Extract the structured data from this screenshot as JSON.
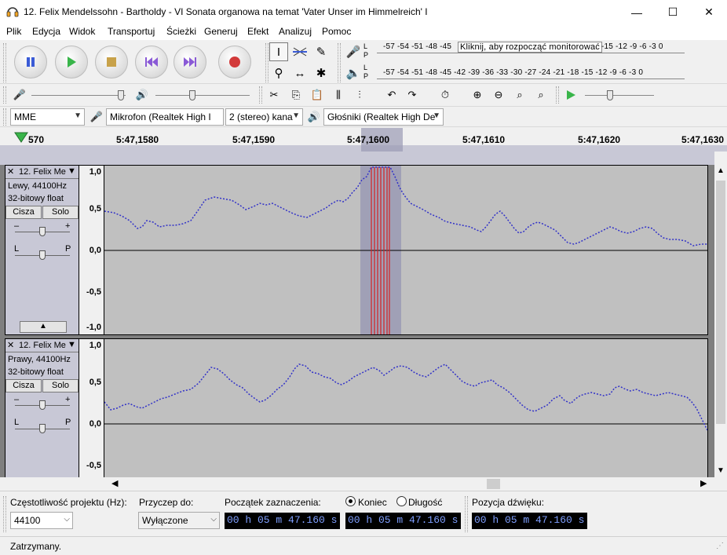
{
  "window": {
    "title": "12. Felix Mendelssohn - Bartholdy - VI Sonata organowa na temat 'Vater Unser im Himmelreich' I",
    "minimize": "—",
    "maximize": "☐",
    "close": "✕"
  },
  "menu": [
    "Plik",
    "Edycja",
    "Widok",
    "Transportuj",
    "Ścieżki",
    "Generuj",
    "Efekt",
    "Analizuj",
    "Pomoc"
  ],
  "meters": {
    "record_scale": "-57 -54 -51 -48 -45",
    "record_tooltip": "Kliknij, aby rozpocząć monitorować",
    "record_scale_right": "-15 -12  -9  -6  -3  0",
    "play_scale": "-57 -54 -51 -48 -45 -42 -39 -36 -33 -30 -27 -24 -21 -18 -15 -12  -9  -6  -3  0",
    "lr_L": "L",
    "lr_R": "P"
  },
  "device": {
    "host": "MME",
    "mic": "Mikrofon (Realtek High I",
    "channels": "2 (stereo) kana",
    "speaker": "Głośniki (Realtek High De"
  },
  "timeline": {
    "labels": [
      "570",
      "5:47,1580",
      "5:47,1590",
      "5:47,1600",
      "5:47,1610",
      "5:47,1620",
      "5:47,1630"
    ]
  },
  "tracks": [
    {
      "name": "12. Felix Me",
      "info1": "Lewy, 44100Hz",
      "info2": "32-bitowy float",
      "mute": "Cisza",
      "solo": "Solo",
      "gain_minus": "–",
      "gain_plus": "+",
      "pan_l": "L",
      "pan_r": "P",
      "scale": [
        "1,0",
        "0,5",
        "0,0",
        "-0,5",
        "-1,0"
      ]
    },
    {
      "name": "12. Felix Me",
      "info1": "Prawy, 44100Hz",
      "info2": "32-bitowy float",
      "mute": "Cisza",
      "solo": "Solo",
      "gain_minus": "–",
      "gain_plus": "+",
      "pan_l": "L",
      "pan_r": "P",
      "scale": [
        "1,0",
        "0,5",
        "0,0",
        "-0,5"
      ]
    }
  ],
  "selection_bar": {
    "rate_label": "Częstotliwość projektu (Hz):",
    "rate_value": "44100",
    "snap_label": "Przyczep do:",
    "snap_value": "Wyłączone",
    "start_label": "Początek zaznaczenia:",
    "end_label": "Koniec",
    "length_label": "Długość",
    "pos_label": "Pozycja dźwięku:",
    "start_time": "00 h 05 m 47.160 s",
    "end_time": "00 h 05 m 47.160 s",
    "pos_time": "00 h 05 m 47.160 s"
  },
  "status": "Zatrzymany.",
  "colors": {
    "wave": "#3232c8",
    "selection": "#9a9ab4",
    "clip_red": "#d42020",
    "time_digits": "#7f9fff"
  }
}
